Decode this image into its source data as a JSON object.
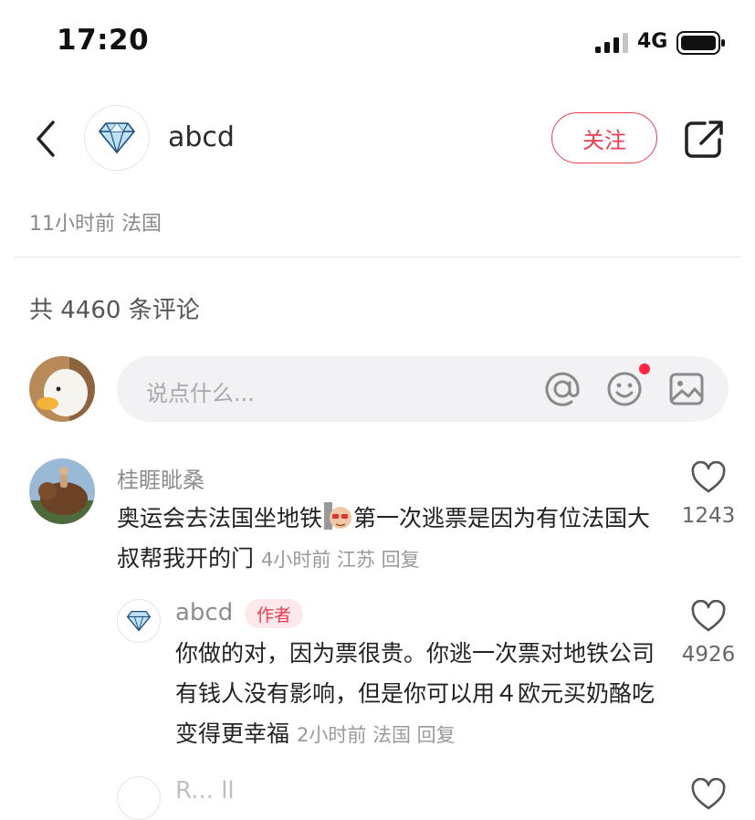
{
  "status_bar": {
    "time": "17:20",
    "network": "4G"
  },
  "header": {
    "username": "abcd",
    "follow_label": "关注"
  },
  "post_meta": "11小时前 法国",
  "comments_count_label": "共 4460 条评论",
  "comment_input": {
    "placeholder": "说点什么..."
  },
  "comments": [
    {
      "username": "桂睚眦桑",
      "text_a": "奥运会去法国坐地铁",
      "text_b": "第一次逃票是因为有位法国大叔帮我开的门",
      "meta": "4小时前 江苏 回复",
      "likes": "1243"
    },
    {
      "username": "abcd",
      "badge": "作者",
      "text": "你做的对，因为票很贵。你逃一次票对地铁公司有钱人没有影响，但是你可以用４欧元买奶酪吃变得更幸福",
      "meta": "2小时前 法国 回复",
      "likes": "4926"
    }
  ],
  "next_comment_peek": {
    "username": "R... ll"
  },
  "colors": {
    "accent": "#ee3d4f",
    "notification_dot": "#ff2442",
    "input_bg": "#f2f2f4"
  }
}
